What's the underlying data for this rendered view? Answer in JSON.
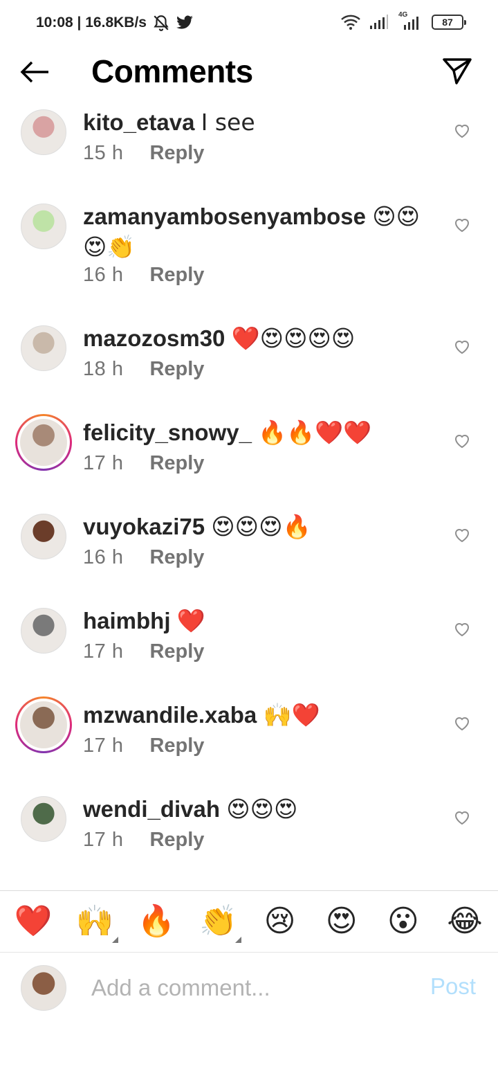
{
  "status_bar": {
    "time_speed": "10:08 | 16.8KB/s",
    "battery": "87",
    "network": "4G"
  },
  "header": {
    "title": "Comments"
  },
  "comments": [
    {
      "user": "kito_etava",
      "text": "I see",
      "time": "15 h",
      "reply": "Reply",
      "ring": false,
      "avatar_color": "#d9a3a3"
    },
    {
      "user": "zamanyambosenyambose",
      "text": "😍😍😍👏",
      "time": "16 h",
      "reply": "Reply",
      "ring": false,
      "avatar_color": "#bfe3a7"
    },
    {
      "user": "mazozosm30",
      "text": "❤️😍😍😍😍",
      "time": "18 h",
      "reply": "Reply",
      "ring": false,
      "avatar_color": "#c9b9aa"
    },
    {
      "user": "felicity_snowy_",
      "text": "🔥🔥❤️❤️",
      "time": "17 h",
      "reply": "Reply",
      "ring": true,
      "avatar_color": "#a88a78"
    },
    {
      "user": "vuyokazi75",
      "text": "😍😍😍🔥",
      "time": "16 h",
      "reply": "Reply",
      "ring": false,
      "avatar_color": "#6b3d2a"
    },
    {
      "user": "haimbhj",
      "text": "❤️",
      "time": "17 h",
      "reply": "Reply",
      "ring": false,
      "avatar_color": "#7a7a7a"
    },
    {
      "user": "mzwandile.xaba",
      "text": "🙌❤️",
      "time": "17 h",
      "reply": "Reply",
      "ring": true,
      "avatar_color": "#8a6a55"
    },
    {
      "user": "wendi_divah",
      "text": "😍😍😍",
      "time": "17 h",
      "reply": "Reply",
      "ring": false,
      "avatar_color": "#4f6b4a"
    }
  ],
  "emoji_bar": [
    "❤️",
    "🙌",
    "🔥",
    "👏",
    "😢",
    "😍",
    "😮",
    "😂"
  ],
  "composer": {
    "placeholder": "Add a comment...",
    "post_label": "Post",
    "avatar_color": "#8b5e45"
  },
  "colors": {
    "text": "#262626",
    "secondary": "#737373",
    "post_disabled": "#b2dffc",
    "ring_gradient": [
      "#f58529",
      "#dd2a7b",
      "#8134af"
    ]
  },
  "icons": {
    "back": "arrow-left-icon",
    "send": "paper-plane-icon",
    "like": "heart-outline-icon",
    "wifi": "wifi-icon",
    "signal": "signal-bars-icon",
    "twitter": "twitter-bird-icon",
    "mute": "bell-off-icon"
  }
}
